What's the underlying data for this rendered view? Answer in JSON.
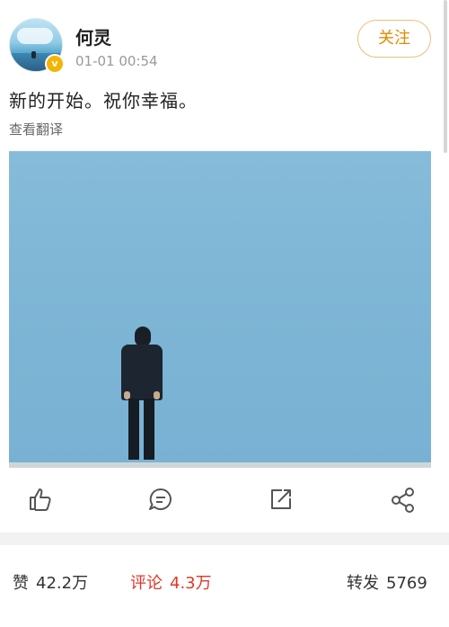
{
  "post": {
    "username": "何灵",
    "time": "01-01 00:54",
    "follow_label": "关注",
    "text": "新的开始。祝你幸福。",
    "translate_label": "查看翻译",
    "badge": "v"
  },
  "actions": {
    "icons": [
      "like-icon",
      "comment-icon",
      "repost-icon",
      "share-icon"
    ]
  },
  "stats": {
    "likes_label": "赞",
    "likes_count": "42.2万",
    "comments_label": "评论",
    "comments_count": "4.3万",
    "reposts_label": "转发",
    "reposts_count": "5769"
  },
  "colors": {
    "accent": "#e38a00",
    "comment_active": "#e2362a",
    "badge": "#f5b400"
  }
}
